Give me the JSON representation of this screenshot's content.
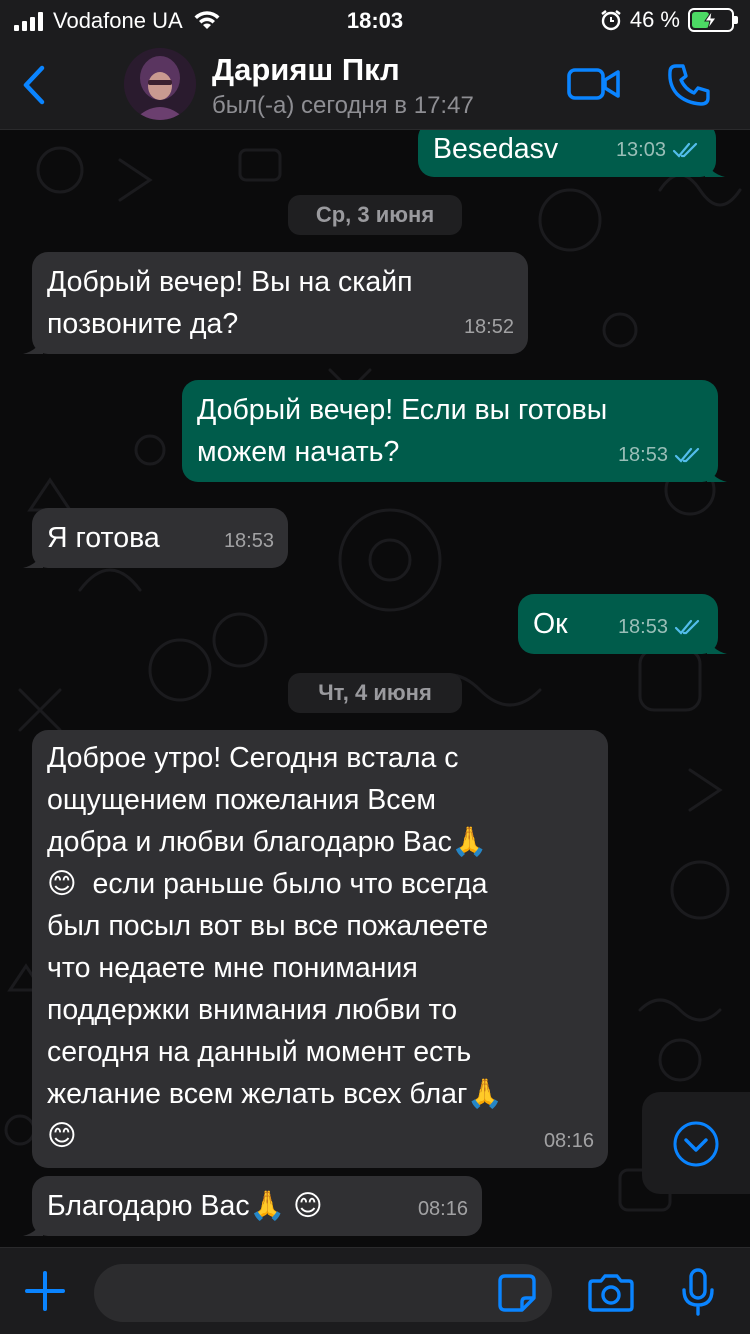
{
  "status_bar": {
    "carrier": "Vodafone UA",
    "time": "18:03",
    "battery_percent_text": "46 %",
    "battery_level": 0.46,
    "icons": [
      "signal-icon",
      "wifi-icon",
      "alarm-icon",
      "battery-charging-icon"
    ]
  },
  "header": {
    "contact_name": "Дарияш Пкл",
    "last_seen": "был(-а) сегодня в 17:47",
    "icons": [
      "back-chevron-icon",
      "video-call-icon",
      "phone-call-icon"
    ],
    "accent_color": "#0a84ff"
  },
  "messages": [
    {
      "direction": "out",
      "text": "Besedasv",
      "time": "13:03",
      "read": true
    },
    {
      "type": "date",
      "text": "Ср, 3 июня"
    },
    {
      "direction": "in",
      "text": "Добрый вечер! Вы на скайп позвоните да?",
      "time": "18:52"
    },
    {
      "direction": "out",
      "text": "Добрый вечер! Если вы готовы можем начать?",
      "time": "18:53",
      "read": true
    },
    {
      "direction": "in",
      "text": "Я готова",
      "time": "18:53"
    },
    {
      "direction": "out",
      "text": "Ок",
      "time": "18:53",
      "read": true
    },
    {
      "type": "date",
      "text": "Чт, 4 июня"
    },
    {
      "direction": "in",
      "text": "Доброе утро! Сегодня встала с ощущением пожелания Всем добра и любви благодарю Вас🙏 😊 если раньше было что всегда был посыл вот вы все пожалеете что недаете мне понимания поддержки внимания любви то сегодня на данный момент есть желание всем желать всех благ🙏 😊",
      "time": "08:16"
    },
    {
      "direction": "in",
      "text": "Благодарю Вас🙏 😊",
      "time": "08:16"
    }
  ],
  "chat_lines": {
    "m0": "Besedasv",
    "d1": "Ср, 3 июня",
    "m2_l1": "Добрый вечер! Вы на скайп",
    "m2_l2": "позвоните да?",
    "m3_l1": "Добрый вечер! Если вы готовы",
    "m3_l2": "можем начать?",
    "m4": "Я готова",
    "m5": "Ок",
    "d6": "Чт, 4 июня",
    "m7_l1": "Доброе утро! Сегодня встала с",
    "m7_l2": "ощущением пожелания Всем",
    "m7_l3": "добра и любви благодарю Вас🙏",
    "m7_l4": "😊  если раньше было что всегда",
    "m7_l5": "был посыл вот вы все пожалеете",
    "m7_l6": "что недаете мне понимания",
    "m7_l7": "поддержки внимания любви то",
    "m7_l8": "сегодня на данный момент есть",
    "m7_l9": "желание всем желать всех благ🙏",
    "m7_l10": "😊",
    "m8": "Благодарю Вас🙏 😊"
  },
  "times": {
    "m0": "13:03",
    "m2": "18:52",
    "m3": "18:53",
    "m4": "18:53",
    "m5": "18:53",
    "m7": "08:16",
    "m8": "08:16"
  },
  "colors": {
    "incoming_bubble": "#303033",
    "outgoing_bubble": "#005c4b",
    "read_ticks": "#53bdeb",
    "background": "#0b0b0c"
  },
  "input_bar": {
    "placeholder": "",
    "icons": [
      "plus-icon",
      "sticker-icon",
      "camera-icon",
      "microphone-icon"
    ]
  },
  "scroll_down_icon": "chevron-down-circle-icon"
}
